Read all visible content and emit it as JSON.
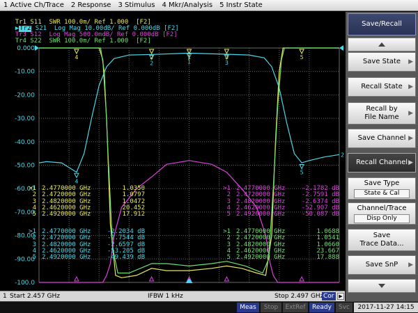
{
  "menubar": {
    "items": [
      "1 Active Ch/Trace",
      "2 Response",
      "3 Stimulus",
      "4 Mkr/Analysis",
      "5 Instr State"
    ]
  },
  "traces": [
    {
      "tag": "Tr1",
      "text": " S11  SWR 100.0m/ Ref 1.000  [F2]",
      "color": "#e8e85a"
    },
    {
      "tag": "Tr2",
      "text": " S21  Log Mag 10.00dB/ Ref 0.000dB [F2]",
      "color": "#4ad8e8",
      "active": true
    },
    {
      "tag": "Tr3",
      "text": " S12  Log Mag 500.0mdB/ Ref 0.000dB [F2]",
      "color": "#e040e0"
    },
    {
      "tag": "Tr4",
      "text": " S22  SWR 100.0m/ Ref 1.000  [F2]",
      "color": "#70e070"
    }
  ],
  "y_axis_labels": [
    "0.000",
    "-10.00",
    "-20.00",
    "-30.00",
    "-40.00",
    "-50.00",
    "-60.00",
    "-70.00",
    "-80.00",
    "-90.00",
    "-100.0"
  ],
  "marker_tables": {
    "tr1": {
      "color": "#e8e85a",
      "rows": [
        {
          "n": ">1",
          "freq": "2.4770000 GHz",
          "val": "1.0350"
        },
        {
          "n": "2",
          "freq": "2.4720000 GHz",
          "val": "1.0797"
        },
        {
          "n": "3",
          "freq": "2.4820000 GHz",
          "val": "1.0472"
        },
        {
          "n": "4",
          "freq": "2.4620000 GHz",
          "val": "20.452"
        },
        {
          "n": "5",
          "freq": "2.4920000 GHz",
          "val": "17.912"
        }
      ]
    },
    "tr2": {
      "color": "#4ad8e8",
      "rows": [
        {
          "n": ">1",
          "freq": "2.4770000 GHz",
          "val": "-2.2034 dB"
        },
        {
          "n": "2",
          "freq": "2.4720000 GHz",
          "val": "-2.7544 dB"
        },
        {
          "n": "3",
          "freq": "2.4820000 GHz",
          "val": "-2.6597 dB"
        },
        {
          "n": "4",
          "freq": "2.4620000 GHz",
          "val": "-53.205 dB"
        },
        {
          "n": "5",
          "freq": "2.4920000 GHz",
          "val": "-49.439 dB"
        }
      ]
    },
    "tr3": {
      "color": "#e040e0",
      "rows": [
        {
          "n": ">1",
          "freq": "2.4770000 GHz",
          "val": "-2.1782 dB"
        },
        {
          "n": "2",
          "freq": "2.4720000 GHz",
          "val": "-2.7591 dB"
        },
        {
          "n": "3",
          "freq": "2.4820000 GHz",
          "val": "-2.6374 dB"
        },
        {
          "n": "4",
          "freq": "2.4620000 GHz",
          "val": "-52.907 dB"
        },
        {
          "n": "5",
          "freq": "2.4920000 GHz",
          "val": "-50.087 dB"
        }
      ]
    },
    "tr4": {
      "color": "#70e070",
      "rows": [
        {
          "n": ">1",
          "freq": "2.4770000 GHz",
          "val": "1.0688"
        },
        {
          "n": "2",
          "freq": "2.4720000 GHz",
          "val": "1.0541"
        },
        {
          "n": "3",
          "freq": "2.4820000 GHz",
          "val": "1.0660"
        },
        {
          "n": "4",
          "freq": "2.4620000 GHz",
          "val": "23.667"
        },
        {
          "n": "5",
          "freq": "2.4920000 GHz",
          "val": "17.888"
        }
      ]
    }
  },
  "side_panel": {
    "header": "Save/Recall",
    "buttons": [
      {
        "label": "Save State",
        "arrow": true
      },
      {
        "label": "Recall State",
        "arrow": true
      },
      {
        "label": "Recall by",
        "label2": "File Name",
        "arrow": true
      },
      {
        "label": "Save Channel",
        "arrow": true
      },
      {
        "label": "Recall Channel",
        "arrow": true,
        "dark": true
      },
      {
        "label": "Save Type",
        "value": "State & Cal"
      },
      {
        "label": "Channel/Trace",
        "value": "Disp Only"
      },
      {
        "label": "Save",
        "label2": "Trace Data..."
      },
      {
        "label": "Save SnP",
        "arrow": true
      }
    ]
  },
  "stimbar": {
    "channel": "1",
    "start": "Start 2.457 GHz",
    "ifbw": "IFBW 1 kHz",
    "stop": "Stop 2.497 GHz",
    "cor": "Cor"
  },
  "statusbar": {
    "meas": "Meas",
    "stop": "Stop",
    "extref": "ExtRef",
    "ready": "Ready",
    "svc": "Svc",
    "datetime": "2017-11-27 14:15"
  },
  "chart_data": {
    "type": "line",
    "x_start_ghz": 2.457,
    "x_stop_ghz": 2.497,
    "ylim": [
      -100,
      0
    ],
    "grid": true,
    "series": [
      {
        "name": "Tr1 S11",
        "color": "#e8e85a",
        "x": [
          2.457,
          2.465,
          2.4655,
          2.466,
          2.4665,
          2.4672,
          2.468,
          2.47,
          2.472,
          2.474,
          2.477,
          2.48,
          2.482,
          2.484,
          2.486,
          2.4872,
          2.488,
          2.4885,
          2.489,
          2.4895,
          2.497
        ],
        "y": [
          0,
          0,
          -5,
          -30,
          -75,
          -97,
          -98,
          -97,
          -94,
          -95,
          -95,
          -94,
          -93,
          -94,
          -96,
          -97,
          -80,
          -40,
          -10,
          0,
          0
        ]
      },
      {
        "name": "Tr2 S21",
        "color": "#4ad8e8",
        "x": [
          2.457,
          2.458,
          2.46,
          2.461,
          2.462,
          2.463,
          2.464,
          2.465,
          2.466,
          2.467,
          2.469,
          2.472,
          2.477,
          2.482,
          2.485,
          2.487,
          2.488,
          2.489,
          2.49,
          2.491,
          2.492,
          2.493,
          2.495,
          2.497
        ],
        "y": [
          -49,
          -48.5,
          -49,
          -51,
          -53,
          -45,
          -30,
          -16,
          -8,
          -4.5,
          -3,
          -2.75,
          -2.2,
          -2.66,
          -3,
          -4.2,
          -8,
          -17,
          -32,
          -45,
          -49,
          -48,
          -46.5,
          -45.5
        ]
      },
      {
        "name": "Tr3 S12",
        "color": "#e040e0",
        "x": [
          2.457,
          2.4655,
          2.466,
          2.4665,
          2.467,
          2.468,
          2.47,
          2.472,
          2.474,
          2.477,
          2.48,
          2.482,
          2.484,
          2.486,
          2.4872,
          2.4878,
          2.4882,
          2.4888,
          2.4895,
          2.497
        ],
        "y": [
          -100,
          -100,
          -97,
          -92,
          -80,
          -68,
          -60,
          -55,
          -49.6,
          -48,
          -49.6,
          -53,
          -60,
          -68,
          -80,
          -92,
          -97,
          -100,
          -100,
          -100
        ]
      },
      {
        "name": "Tr4 S22",
        "color": "#70e070",
        "x": [
          2.457,
          2.4652,
          2.4657,
          2.4662,
          2.4668,
          2.4675,
          2.469,
          2.472,
          2.474,
          2.477,
          2.48,
          2.482,
          2.4845,
          2.4868,
          2.4876,
          2.4882,
          2.4888,
          2.4893,
          2.4897,
          2.497
        ],
        "y": [
          0,
          0,
          -10,
          -45,
          -85,
          -96,
          -96,
          -92,
          -92,
          -93,
          -92,
          -91,
          -93,
          -96,
          -90,
          -60,
          -25,
          -5,
          0,
          0
        ]
      }
    ],
    "markers": [
      {
        "n": "1",
        "x": 2.477,
        "y": -2.2
      },
      {
        "n": "2",
        "x": 2.472,
        "y": -2.75
      },
      {
        "n": "3",
        "x": 2.482,
        "y": -2.66
      },
      {
        "n": "4",
        "x": 2.462,
        "y": -53.2
      },
      {
        "n": "5",
        "x": 2.492,
        "y": -49.4
      }
    ]
  }
}
